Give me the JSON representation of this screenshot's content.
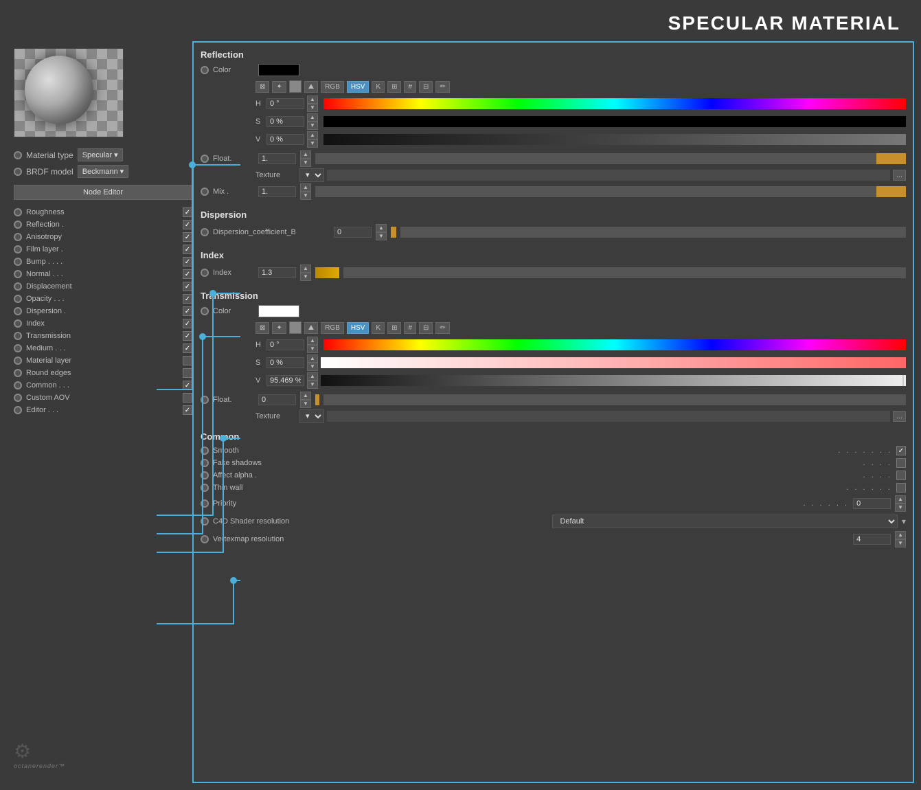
{
  "page": {
    "title": "SPECULAR MATERIAL"
  },
  "sidebar": {
    "material_type_label": "Material type",
    "material_type_value": "Specular",
    "brdf_model_label": "BRDF model",
    "brdf_model_value": "Beckmann",
    "node_editor_label": "Node Editor",
    "channels": [
      {
        "name": "Roughness",
        "checked": true
      },
      {
        "name": "Reflection",
        "checked": true
      },
      {
        "name": "Anisotropy",
        "checked": true
      },
      {
        "name": "Film layer",
        "checked": true
      },
      {
        "name": "Bump",
        "checked": true
      },
      {
        "name": "Normal",
        "checked": true
      },
      {
        "name": "Displacement",
        "checked": true
      },
      {
        "name": "Opacity",
        "checked": true
      },
      {
        "name": "Dispersion",
        "checked": true
      },
      {
        "name": "Index",
        "checked": true
      },
      {
        "name": "Transmission",
        "checked": true
      },
      {
        "name": "Medium",
        "checked": true
      },
      {
        "name": "Material layer",
        "checked": false
      },
      {
        "name": "Round edges",
        "checked": false
      },
      {
        "name": "Common",
        "checked": true
      },
      {
        "name": "Custom AOV",
        "checked": false
      },
      {
        "name": "Editor",
        "checked": true
      }
    ]
  },
  "reflection": {
    "title": "Reflection",
    "color_label": "Color",
    "color_value": "#000000",
    "hsv": {
      "h_label": "H",
      "h_value": "0 °",
      "s_label": "S",
      "s_value": "0 %",
      "v_label": "V",
      "v_value": "0 %"
    },
    "color_mode_buttons": [
      "RGB",
      "HSV",
      "K",
      "⊞",
      "#",
      "⊟"
    ],
    "float_label": "Float.",
    "float_value": "1.",
    "texture_label": "Texture",
    "mix_label": "Mix .",
    "mix_value": "1."
  },
  "dispersion": {
    "title": "Dispersion",
    "coeff_label": "Dispersion_coefficient_B",
    "coeff_value": "0"
  },
  "index": {
    "title": "Index",
    "label": "Index",
    "value": "1.3"
  },
  "transmission": {
    "title": "Transmission",
    "color_label": "Color",
    "color_value": "#ffffff",
    "hsv": {
      "h_label": "H",
      "h_value": "0 °",
      "s_label": "S",
      "s_value": "0 %",
      "v_label": "V",
      "v_value": "95.469 %"
    },
    "float_label": "Float.",
    "float_value": "0",
    "texture_label": "Texture"
  },
  "common": {
    "title": "Common",
    "smooth_label": "Smooth",
    "smooth_checked": true,
    "fake_shadows_label": "Fake shadows",
    "fake_shadows_checked": false,
    "affect_alpha_label": "Affect alpha .",
    "affect_alpha_checked": false,
    "thin_wall_label": "Thin wall",
    "thin_wall_checked": false,
    "priority_label": "Priority",
    "priority_value": "0",
    "c4d_shader_label": "C4D Shader resolution",
    "c4d_shader_value": "Default",
    "vertexmap_label": "Vertexmap resolution",
    "vertexmap_value": "4"
  },
  "icons": {
    "radio": "○",
    "check": "✓",
    "chevron_down": "▾",
    "eyedropper": "🖉",
    "up_arrow": "▲",
    "down_arrow": "▼",
    "dots": "..."
  }
}
